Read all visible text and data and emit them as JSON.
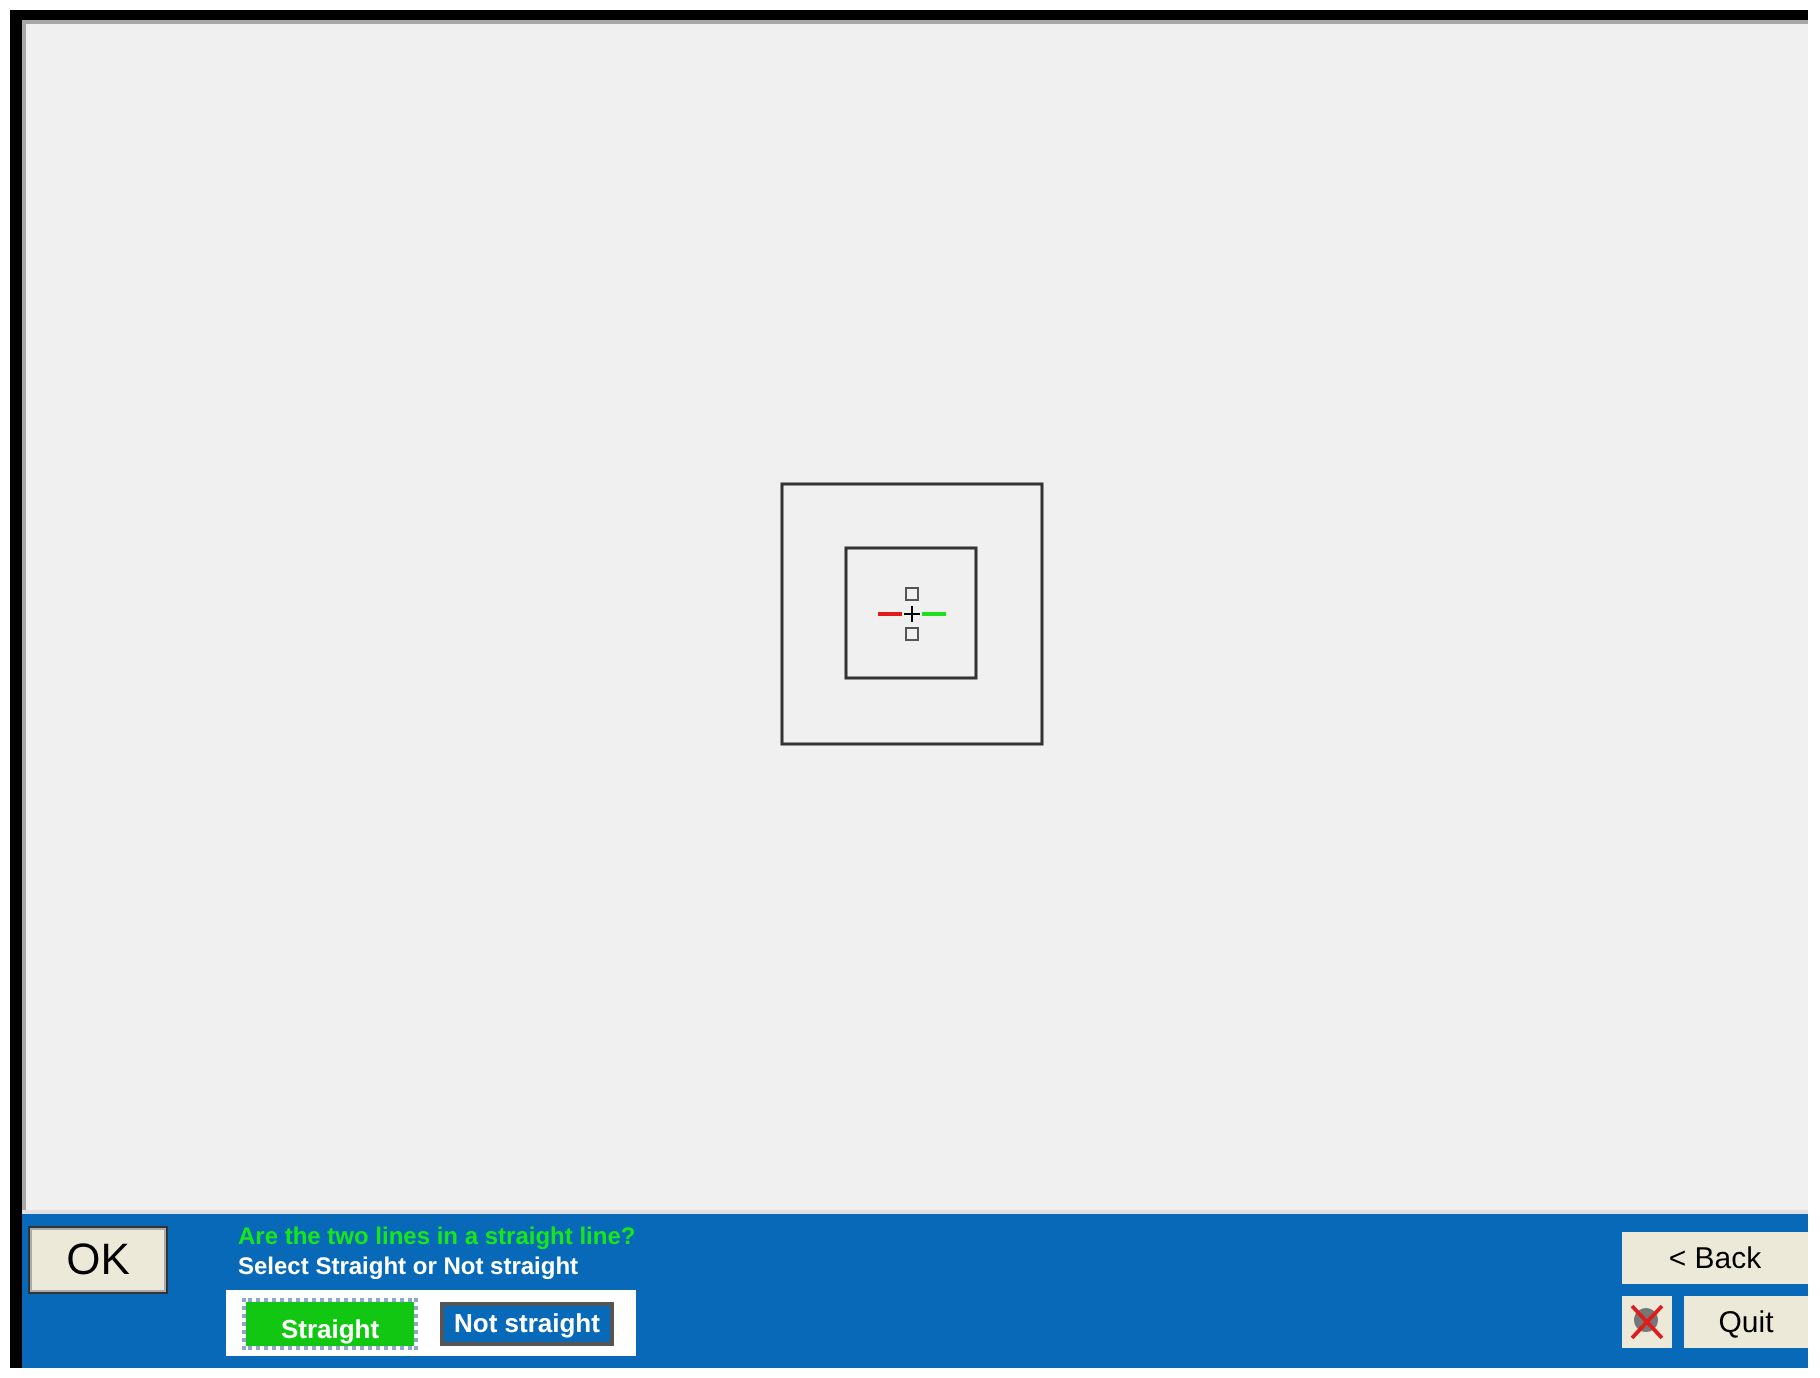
{
  "question": "Are the two lines in a straight line?",
  "instruction": "Select Straight or Not straight",
  "ok_button": "OK",
  "options": [
    {
      "label": "Straight",
      "selected": true
    },
    {
      "label": "Not straight",
      "selected": false
    }
  ],
  "back_button": "< Back",
  "quit_button": "Quit"
}
